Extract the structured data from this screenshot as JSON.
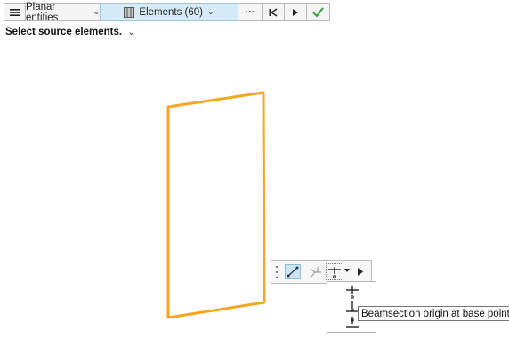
{
  "toolbar": {
    "menu_icon": "hamburger-menu-icon",
    "filter_label": "Planar entities",
    "selection_label": "Elements (60)",
    "selection_icon": "element-grid-icon",
    "more_label": "···",
    "colors": {
      "active_bg": "#d5ebf8",
      "confirm": "#2ea043"
    }
  },
  "instruction": {
    "text": "Select source elements."
  },
  "canvas": {
    "element_color": "#f5a623"
  },
  "mini_toolbar": {
    "tools": [
      "line-direction-icon",
      "vector-axes-icon",
      "beamsection-icon",
      "play-icon"
    ]
  },
  "dropdown": {
    "items": [
      "beamsection-origin-top-icon",
      "beamsection-origin-base-icon",
      "beamsection-origin-bottom-icon"
    ]
  },
  "tooltip": {
    "text": "Beamsection origin at base point"
  }
}
